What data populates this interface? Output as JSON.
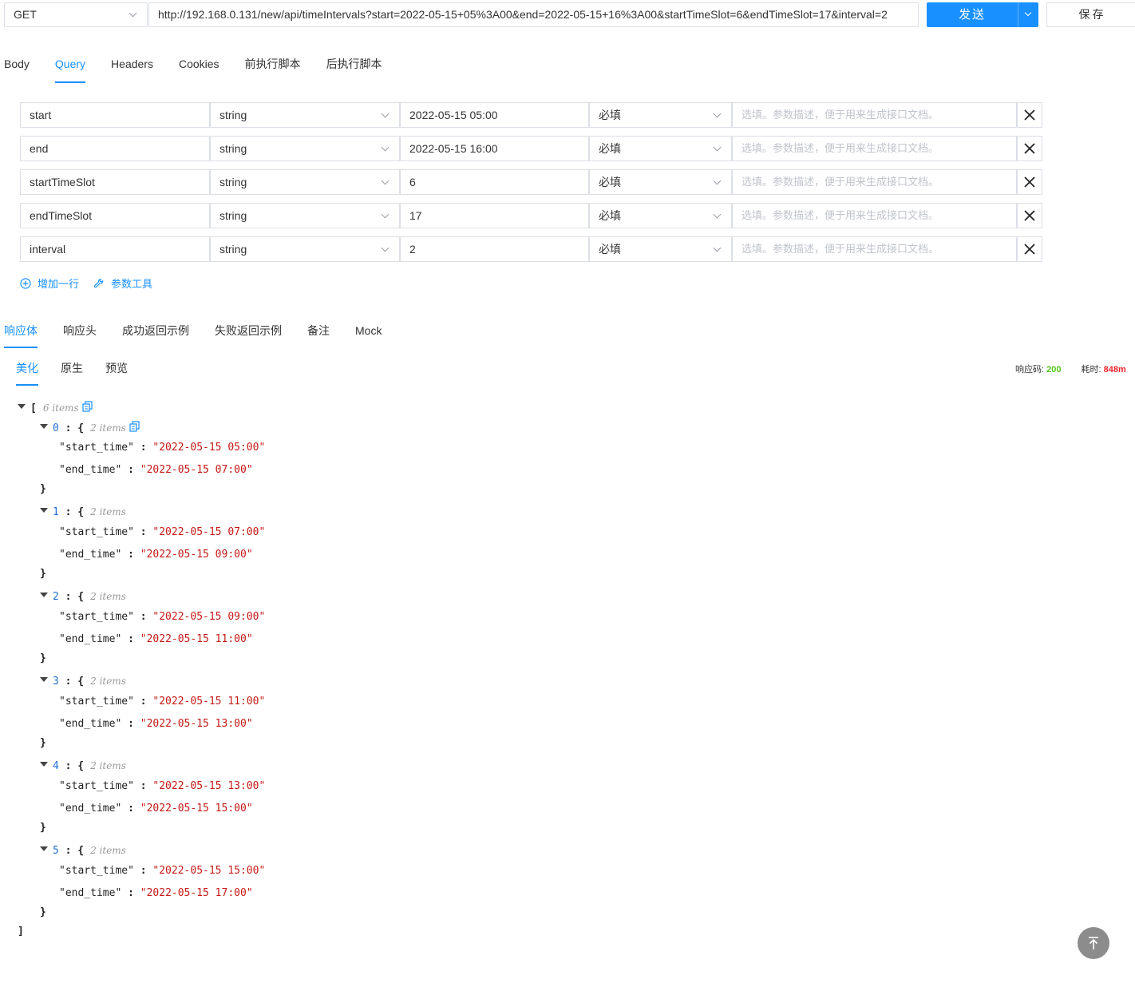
{
  "request": {
    "method": "GET",
    "url": "http://192.168.0.131/new/api/timeIntervals?start=2022-05-15+05%3A00&end=2022-05-15+16%3A00&startTimeSlot=6&endTimeSlot=17&interval=2",
    "send_label": "发送",
    "save_label": "保存"
  },
  "request_tabs": [
    "Body",
    "Query",
    "Headers",
    "Cookies",
    "前执行脚本",
    "后执行脚本"
  ],
  "active_request_tab": "Query",
  "params": [
    {
      "name": "start",
      "type": "string",
      "value": "2022-05-15 05:00",
      "required": "必填",
      "desc_placeholder": "选填。参数描述，便于用来生成接口文档。"
    },
    {
      "name": "end",
      "type": "string",
      "value": "2022-05-15 16:00",
      "required": "必填",
      "desc_placeholder": "选填。参数描述，便于用来生成接口文档。"
    },
    {
      "name": "startTimeSlot",
      "type": "string",
      "value": "6",
      "required": "必填",
      "desc_placeholder": "选填。参数描述，便于用来生成接口文档。"
    },
    {
      "name": "endTimeSlot",
      "type": "string",
      "value": "17",
      "required": "必填",
      "desc_placeholder": "选填。参数描述，便于用来生成接口文档。"
    },
    {
      "name": "interval",
      "type": "string",
      "value": "2",
      "required": "必填",
      "desc_placeholder": "选填。参数描述，便于用来生成接口文档。"
    }
  ],
  "param_actions": {
    "add_row": "增加一行",
    "param_tool": "参数工具"
  },
  "response_tabs": [
    "响应体",
    "响应头",
    "成功返回示例",
    "失败返回示例",
    "备注",
    "Mock"
  ],
  "active_response_tab": "响应体",
  "view_tabs": [
    "美化",
    "原生",
    "预览"
  ],
  "active_view_tab": "美化",
  "status": {
    "code_label": "响应码:",
    "code": "200",
    "time_label": "耗时:",
    "time": "848m"
  },
  "json_view": {
    "root_meta": "6 items",
    "item_meta": "2 items",
    "items": [
      {
        "index": "0",
        "start_time": "2022-05-15 05:00",
        "end_time": "2022-05-15 07:00"
      },
      {
        "index": "1",
        "start_time": "2022-05-15 07:00",
        "end_time": "2022-05-15 09:00"
      },
      {
        "index": "2",
        "start_time": "2022-05-15 09:00",
        "end_time": "2022-05-15 11:00"
      },
      {
        "index": "3",
        "start_time": "2022-05-15 11:00",
        "end_time": "2022-05-15 13:00"
      },
      {
        "index": "4",
        "start_time": "2022-05-15 13:00",
        "end_time": "2022-05-15 15:00"
      },
      {
        "index": "5",
        "start_time": "2022-05-15 15:00",
        "end_time": "2022-05-15 17:00"
      }
    ]
  },
  "colors": {
    "accent": "#1890ff",
    "status_ok": "#52c41a",
    "status_time": "#f5222d",
    "json_string": "#c41a16"
  },
  "icons": {
    "add_row": "plus-circle-icon",
    "param_tool": "wrench-icon",
    "delete": "close-icon",
    "copy": "copy-icon",
    "back_to_top": "arrow-up-icon"
  }
}
